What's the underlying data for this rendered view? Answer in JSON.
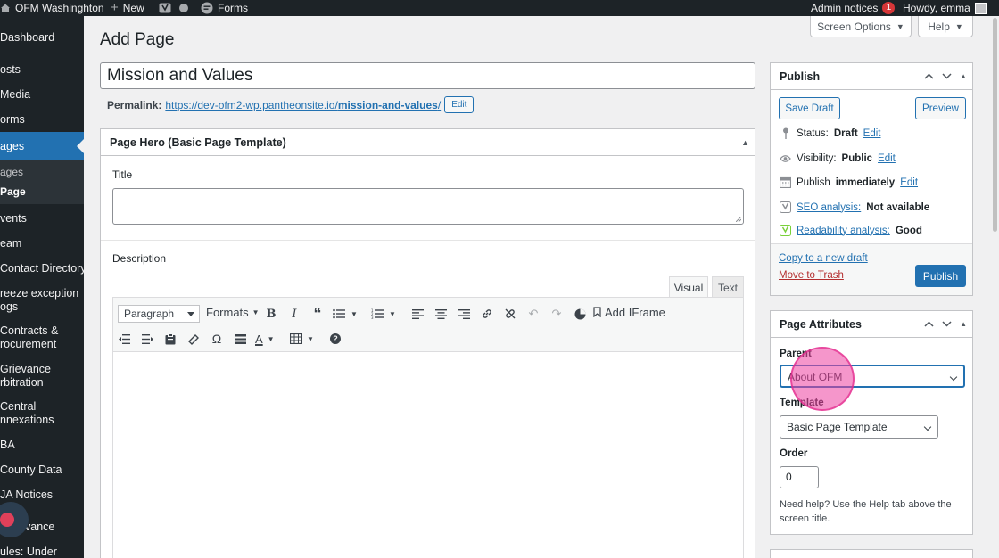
{
  "admin_bar": {
    "site_name": "OFM Washinghton",
    "new_label": "New",
    "forms_label": "Forms",
    "admin_notices_label": "Admin notices",
    "admin_notices_count": "1",
    "howdy": "Howdy, emma"
  },
  "sidebar": {
    "items": [
      {
        "label": "Dashboard"
      },
      {
        "label": "osts"
      },
      {
        "label": "Media"
      },
      {
        "label": "orms"
      },
      {
        "label": "ages"
      },
      {
        "label": "vents"
      },
      {
        "label": "eam"
      },
      {
        "label": "Contact Directory"
      },
      {
        "label": "reeze exception"
      },
      {
        "label": "ogs"
      },
      {
        "label": "Contracts &"
      },
      {
        "label": "rocurement"
      },
      {
        "label": "Grievance"
      },
      {
        "label": "rbitration"
      },
      {
        "label": "Central"
      },
      {
        "label": "nnexations"
      },
      {
        "label": "BA"
      },
      {
        "label": "County Data"
      },
      {
        "label": "JA Notices"
      },
      {
        "label": "vance"
      },
      {
        "label": "ules: Under"
      }
    ],
    "submenu": [
      {
        "label": "ages"
      },
      {
        "label": "Page"
      }
    ]
  },
  "header": {
    "screen_options": "Screen Options",
    "help": "Help",
    "page_title": "Add Page"
  },
  "title_field": {
    "value": "Mission and Values"
  },
  "permalink": {
    "label": "Permalink:",
    "url_base": "https://dev-ofm2-wp.pantheonsite.io/",
    "url_slug": "mission-and-values",
    "url_end": "/",
    "edit_label": "Edit"
  },
  "hero_box": {
    "title": "Page Hero (Basic Page Template)",
    "title_field_label": "Title",
    "description_label": "Description",
    "tab_visual": "Visual",
    "tab_text": "Text",
    "format_select": "Paragraph",
    "formats_menu": "Formats",
    "add_iframe": "Add IFrame"
  },
  "publish_box": {
    "title": "Publish",
    "save_draft": "Save Draft",
    "preview": "Preview",
    "status_label": "Status:",
    "status_value": "Draft",
    "visibility_label": "Visibility:",
    "visibility_value": "Public",
    "publish_label": "Publish",
    "publish_value": "immediately",
    "seo_label": "SEO analysis:",
    "seo_value": "Not available",
    "readability_label": "Readability analysis:",
    "readability_value": "Good",
    "edit_link": "Edit",
    "copy_draft": "Copy to a new draft",
    "move_trash": "Move to Trash",
    "publish_button": "Publish"
  },
  "attributes_box": {
    "title": "Page Attributes",
    "parent_label": "Parent",
    "parent_value": "About OFM",
    "template_label": "Template",
    "template_value": "Basic Page Template",
    "order_label": "Order",
    "order_value": "0",
    "help_text": "Need help? Use the Help tab above the screen title."
  },
  "colors": {
    "admin_bar": "#1d2327",
    "accent": "#2271b1",
    "trash": "#b32d2e",
    "cursor_highlight": "#ec40a0"
  }
}
